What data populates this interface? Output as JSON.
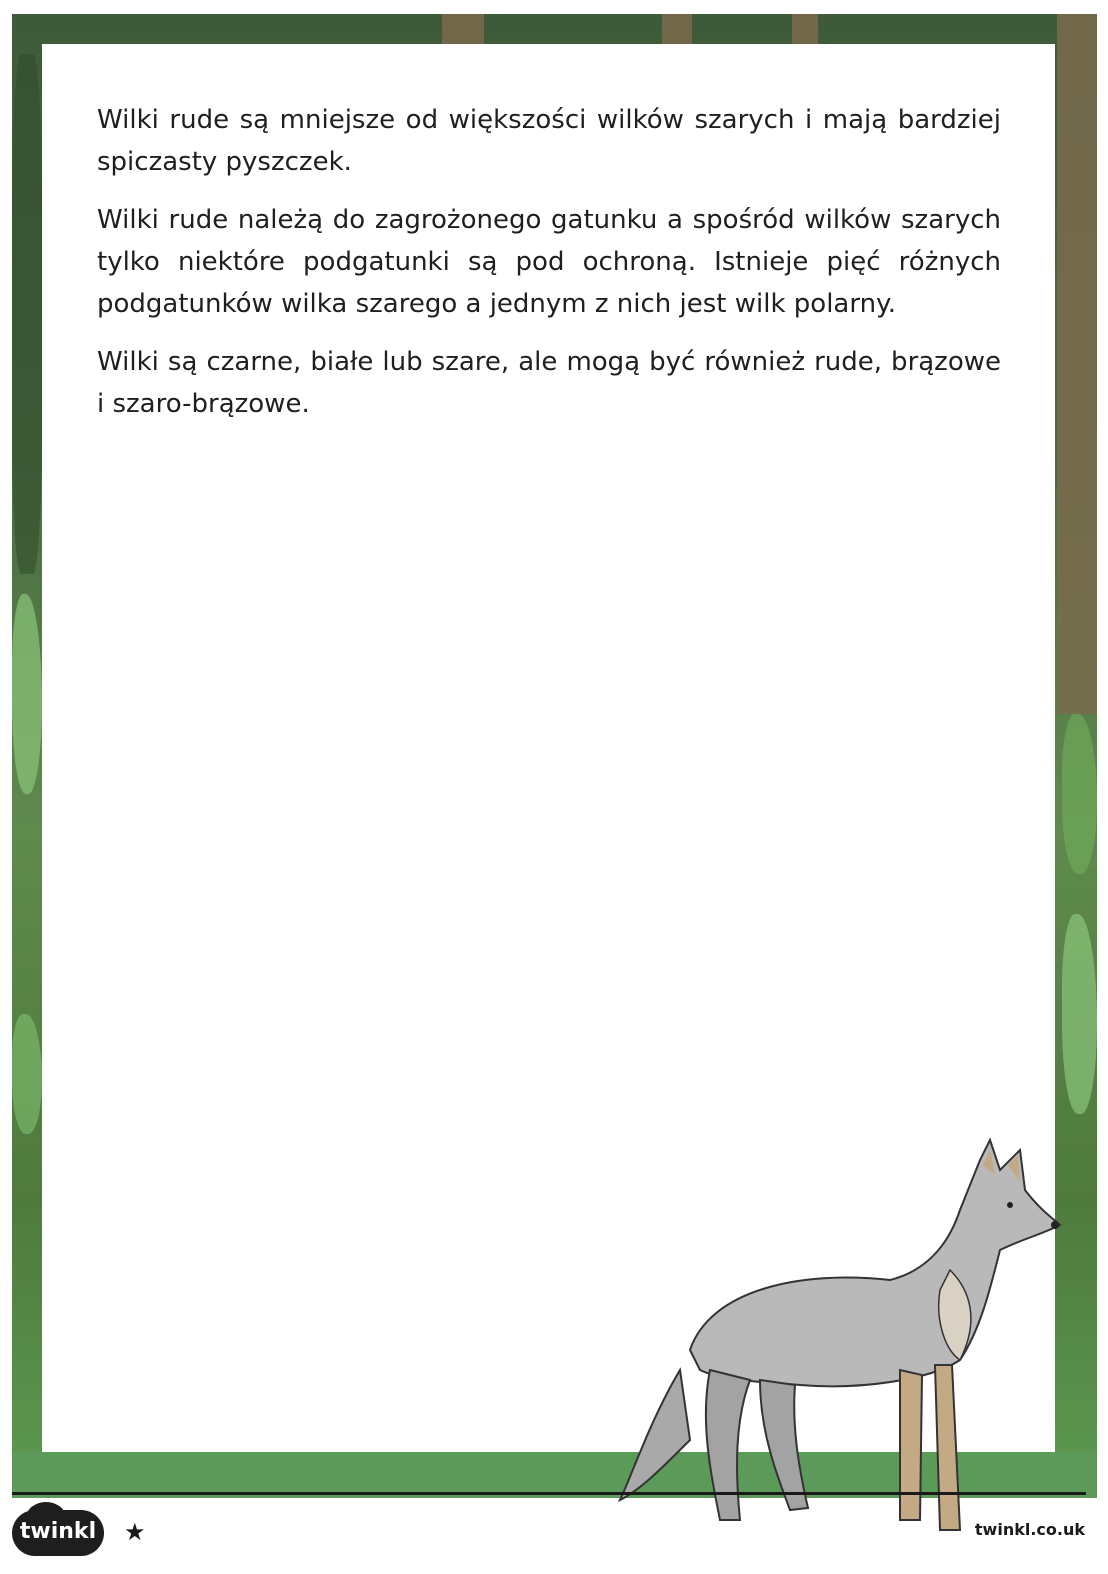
{
  "paragraphs": [
    "Wilki rude są mniejsze od większości wilków szarych i mają bardziej spiczasty pyszczek.",
    "Wilki rude należą do zagrożonego gatunku a spośród wilków szarych tylko niektóre podgatunki są pod ochroną. Istnieje pięć różnych podgatunków wilka szarego a jednym z nich jest wilk polarny.",
    "Wilki są czarne, białe lub szare, ale mogą być również rude, brązowe i szaro-brązowe."
  ],
  "footer": {
    "logo_text": "twinkl",
    "star_icon": "star-icon",
    "site": "twinkl.co.uk"
  },
  "illustration": {
    "icon": "wolf-illustration"
  },
  "colors": {
    "border": "#4a6b42",
    "text": "#1f1f1f"
  }
}
